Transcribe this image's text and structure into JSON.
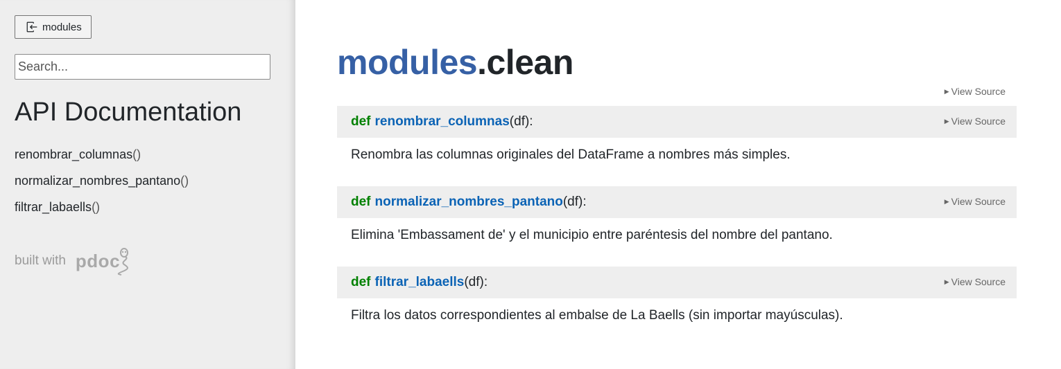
{
  "sidebar": {
    "back_label": "modules",
    "search_placeholder": "Search...",
    "heading": "API Documentation",
    "nav": [
      {
        "name": "renombrar_columnas",
        "suffix": "()"
      },
      {
        "name": "normalizar_nombres_pantano",
        "suffix": "()"
      },
      {
        "name": "filtrar_labaells",
        "suffix": "()"
      }
    ],
    "built_with": "built with",
    "logo_text": "pdoc"
  },
  "main": {
    "module_prefix": "modules",
    "module_sep": ".",
    "module_name": "clean",
    "view_source_label": "View Source",
    "functions": [
      {
        "keyword": "def",
        "name": "renombrar_columnas",
        "args": "(df):",
        "doc": "Renombra las columnas originales del DataFrame a nombres más simples."
      },
      {
        "keyword": "def",
        "name": "normalizar_nombres_pantano",
        "args": "(df):",
        "doc": "Elimina 'Embassament de' y el municipio entre paréntesis del nombre del pantano."
      },
      {
        "keyword": "def",
        "name": "filtrar_labaells",
        "args": "(df):",
        "doc": "Filtra los datos correspondientes al embalse de La Baells (sin importar mayúsculas)."
      }
    ]
  },
  "colors": {
    "module_prefix": "#3660a5",
    "def_keyword": "#008000",
    "function_name": "#0b63b5",
    "signature_bg": "#eeeeee",
    "sidebar_bg": "#eeeeee"
  },
  "icons": {
    "back": "box-arrow-in-left-icon",
    "view_source": "caret-right-icon",
    "logo": "pdoc-snake-icon"
  }
}
